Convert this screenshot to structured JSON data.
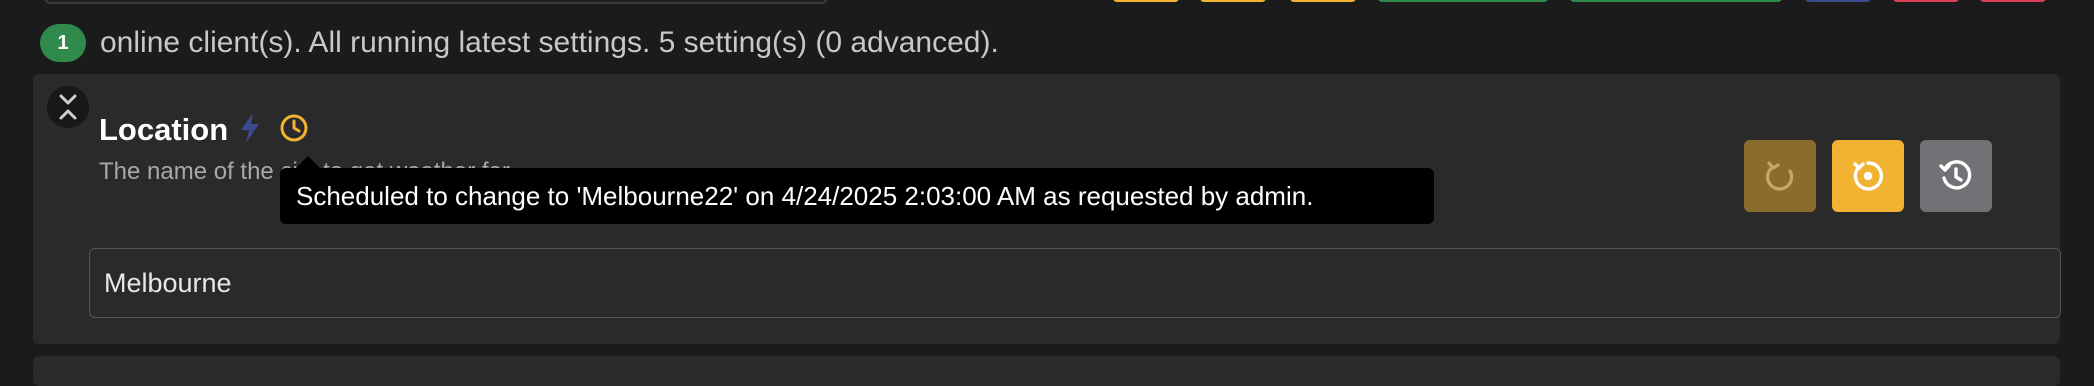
{
  "status": {
    "client_count": "1",
    "message": "online client(s). All running latest settings. 5 setting(s) (0 advanced)."
  },
  "setting": {
    "title": "Location",
    "description": "The name of the city to get weather for.",
    "value": "Melbourne",
    "tooltip": "Scheduled to change to 'Melbourne22' on 4/24/2025 2:03:00 AM as requested by admin."
  },
  "icons": {
    "collapse": "collapse-icon",
    "bolt": "bolt-icon",
    "clock": "clock-icon",
    "revert": "revert-icon",
    "apply": "apply-icon",
    "history": "history-icon"
  },
  "colors": {
    "badge_green": "#2f8a4c",
    "accent_orange": "#f2b232",
    "revert_dim": "#8b6c2e",
    "history_gray": "#707275",
    "bolt_blue": "#3a4a8c"
  }
}
